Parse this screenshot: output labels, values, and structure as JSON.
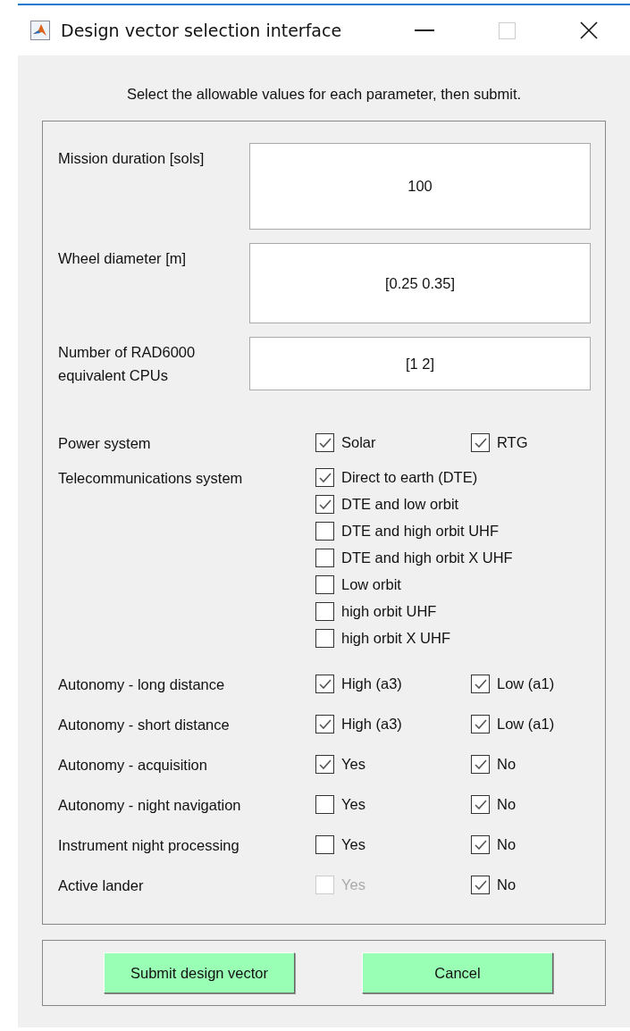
{
  "window": {
    "title": "Design vector selection interface"
  },
  "instruction": "Select the allowable values for each parameter, then submit.",
  "fields": [
    {
      "label": "Mission duration [sols]",
      "value": "100"
    },
    {
      "label": "Wheel diameter [m]",
      "value": "[0.25 0.35]"
    },
    {
      "label": "Number of RAD6000 equivalent CPUs",
      "value": "[1 2]"
    }
  ],
  "parameters": [
    {
      "label": "Power system",
      "kind": "pair",
      "options": [
        {
          "label": "Solar",
          "checked": true,
          "disabled": false
        },
        {
          "label": "RTG",
          "checked": true,
          "disabled": false
        }
      ]
    },
    {
      "label": "Telecommunications system",
      "kind": "list",
      "options": [
        {
          "label": "Direct to earth (DTE)",
          "checked": true,
          "disabled": false
        },
        {
          "label": "DTE and low orbit",
          "checked": true,
          "disabled": false
        },
        {
          "label": "DTE and high orbit UHF",
          "checked": false,
          "disabled": false
        },
        {
          "label": "DTE and high orbit X UHF",
          "checked": false,
          "disabled": false
        },
        {
          "label": "Low orbit",
          "checked": false,
          "disabled": false
        },
        {
          "label": "high orbit UHF",
          "checked": false,
          "disabled": false
        },
        {
          "label": "high orbit X UHF",
          "checked": false,
          "disabled": false
        }
      ]
    },
    {
      "label": "Autonomy - long distance",
      "kind": "pair",
      "options": [
        {
          "label": "High (a3)",
          "checked": true,
          "disabled": false
        },
        {
          "label": "Low (a1)",
          "checked": true,
          "disabled": false
        }
      ]
    },
    {
      "label": "Autonomy - short distance",
      "kind": "pair",
      "options": [
        {
          "label": "High (a3)",
          "checked": true,
          "disabled": false
        },
        {
          "label": "Low (a1)",
          "checked": true,
          "disabled": false
        }
      ]
    },
    {
      "label": "Autonomy - acquisition",
      "kind": "pair",
      "options": [
        {
          "label": "Yes",
          "checked": true,
          "disabled": false
        },
        {
          "label": "No",
          "checked": true,
          "disabled": false
        }
      ]
    },
    {
      "label": "Autonomy - night navigation",
      "kind": "pair",
      "options": [
        {
          "label": "Yes",
          "checked": false,
          "disabled": false
        },
        {
          "label": "No",
          "checked": true,
          "disabled": false
        }
      ]
    },
    {
      "label": "Instrument night processing",
      "kind": "pair",
      "options": [
        {
          "label": "Yes",
          "checked": false,
          "disabled": false
        },
        {
          "label": "No",
          "checked": true,
          "disabled": false
        }
      ]
    },
    {
      "label": "Active lander",
      "kind": "pair",
      "options": [
        {
          "label": "Yes",
          "checked": false,
          "disabled": true
        },
        {
          "label": "No",
          "checked": true,
          "disabled": false
        }
      ]
    }
  ],
  "buttons": [
    "Submit design vector",
    "Cancel"
  ]
}
